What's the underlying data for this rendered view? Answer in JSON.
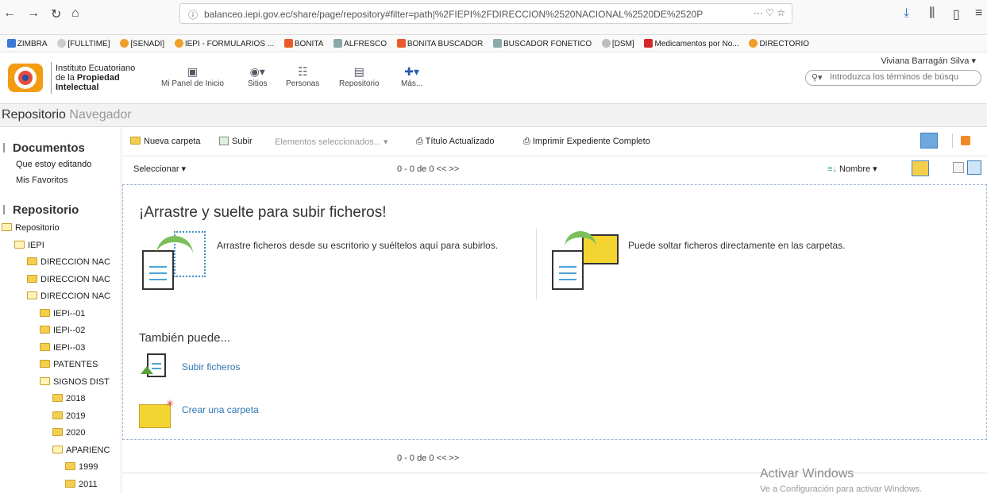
{
  "browser": {
    "url": "balanceo.iepi.gov.ec/share/page/repository#filter=path|%2FIEPI%2FDIRECCION%2520NACIONAL%2520DE%2520P",
    "bookmarks": [
      "ZIMBRA",
      "[FULLTIME]",
      "[SENADI]",
      "IEPI - FORMULARIOS ...",
      "BONITA",
      "ALFRESCO",
      "BONITA BUSCADOR",
      "BUSCADOR FONETICO",
      "[DSM]",
      "Medicamentos por No...",
      "DIRECTORIO"
    ]
  },
  "header": {
    "logo_line1": "Instituto Ecuatoriano",
    "logo_line2": "de la",
    "logo_line2b": "Propiedad",
    "logo_line3": "Intelectual",
    "nav": [
      "Mi Panel de Inicio",
      "Sitios",
      "Personas",
      "Repositorio",
      "Más..."
    ],
    "user": "Viviana Barragán Silva ▾",
    "search_placeholder": "Introduzca los términos de búsqu"
  },
  "title_bar": {
    "main": "Repositorio",
    "sub": "Navegador"
  },
  "sidebar": {
    "documents_heading": "Documentos",
    "documents_links": [
      "Que estoy editando",
      "Mis Favoritos"
    ],
    "repo_heading": "Repositorio",
    "tree": [
      {
        "label": "Repositorio",
        "depth": 0,
        "open": true
      },
      {
        "label": "IEPI",
        "depth": 1,
        "open": true
      },
      {
        "label": "DIRECCION NAC",
        "depth": 2,
        "open": false
      },
      {
        "label": "DIRECCION NAC",
        "depth": 2,
        "open": false
      },
      {
        "label": "DIRECCION NAC",
        "depth": 2,
        "open": true
      },
      {
        "label": "IEPI--01",
        "depth": 3,
        "open": false
      },
      {
        "label": "IEPI--02",
        "depth": 3,
        "open": false
      },
      {
        "label": "IEPI--03",
        "depth": 3,
        "open": false
      },
      {
        "label": "PATENTES",
        "depth": 3,
        "open": false
      },
      {
        "label": "SIGNOS DIST",
        "depth": 3,
        "open": true
      },
      {
        "label": "2018",
        "depth": 4,
        "open": false
      },
      {
        "label": "2019",
        "depth": 4,
        "open": false
      },
      {
        "label": "2020",
        "depth": 4,
        "open": false
      },
      {
        "label": "APARIENC",
        "depth": 4,
        "open": true
      },
      {
        "label": "1999",
        "depth": 5,
        "open": false
      },
      {
        "label": "2011",
        "depth": 5,
        "open": false
      }
    ]
  },
  "toolbar": {
    "new_folder": "Nueva carpeta",
    "upload": "Subir",
    "selected": "Elementos seleccionados... ▾",
    "title_updated": "Título Actualizado",
    "print_full": "Imprimir Expediente Completo",
    "select": "Seleccionar ▾",
    "pager": "0 - 0 de 0    <<    >>",
    "sort": "Nombre ▾"
  },
  "dropzone": {
    "title": "¡Arrastre y suelte para subir ficheros!",
    "desktop_text": "Arrastre ficheros desde su escritorio y suéltelos aquí para subirlos.",
    "folder_text": "Puede soltar ficheros directamente en las carpetas.",
    "also": "También puede...",
    "upload_link": "Subir ficheros",
    "create_link": "Crear una carpeta"
  },
  "pager_bottom": "0 - 0 de 0    <<    >>",
  "watermark": {
    "line1": "Activar Windows",
    "line2": "Ve a Configuración para activar Windows."
  }
}
